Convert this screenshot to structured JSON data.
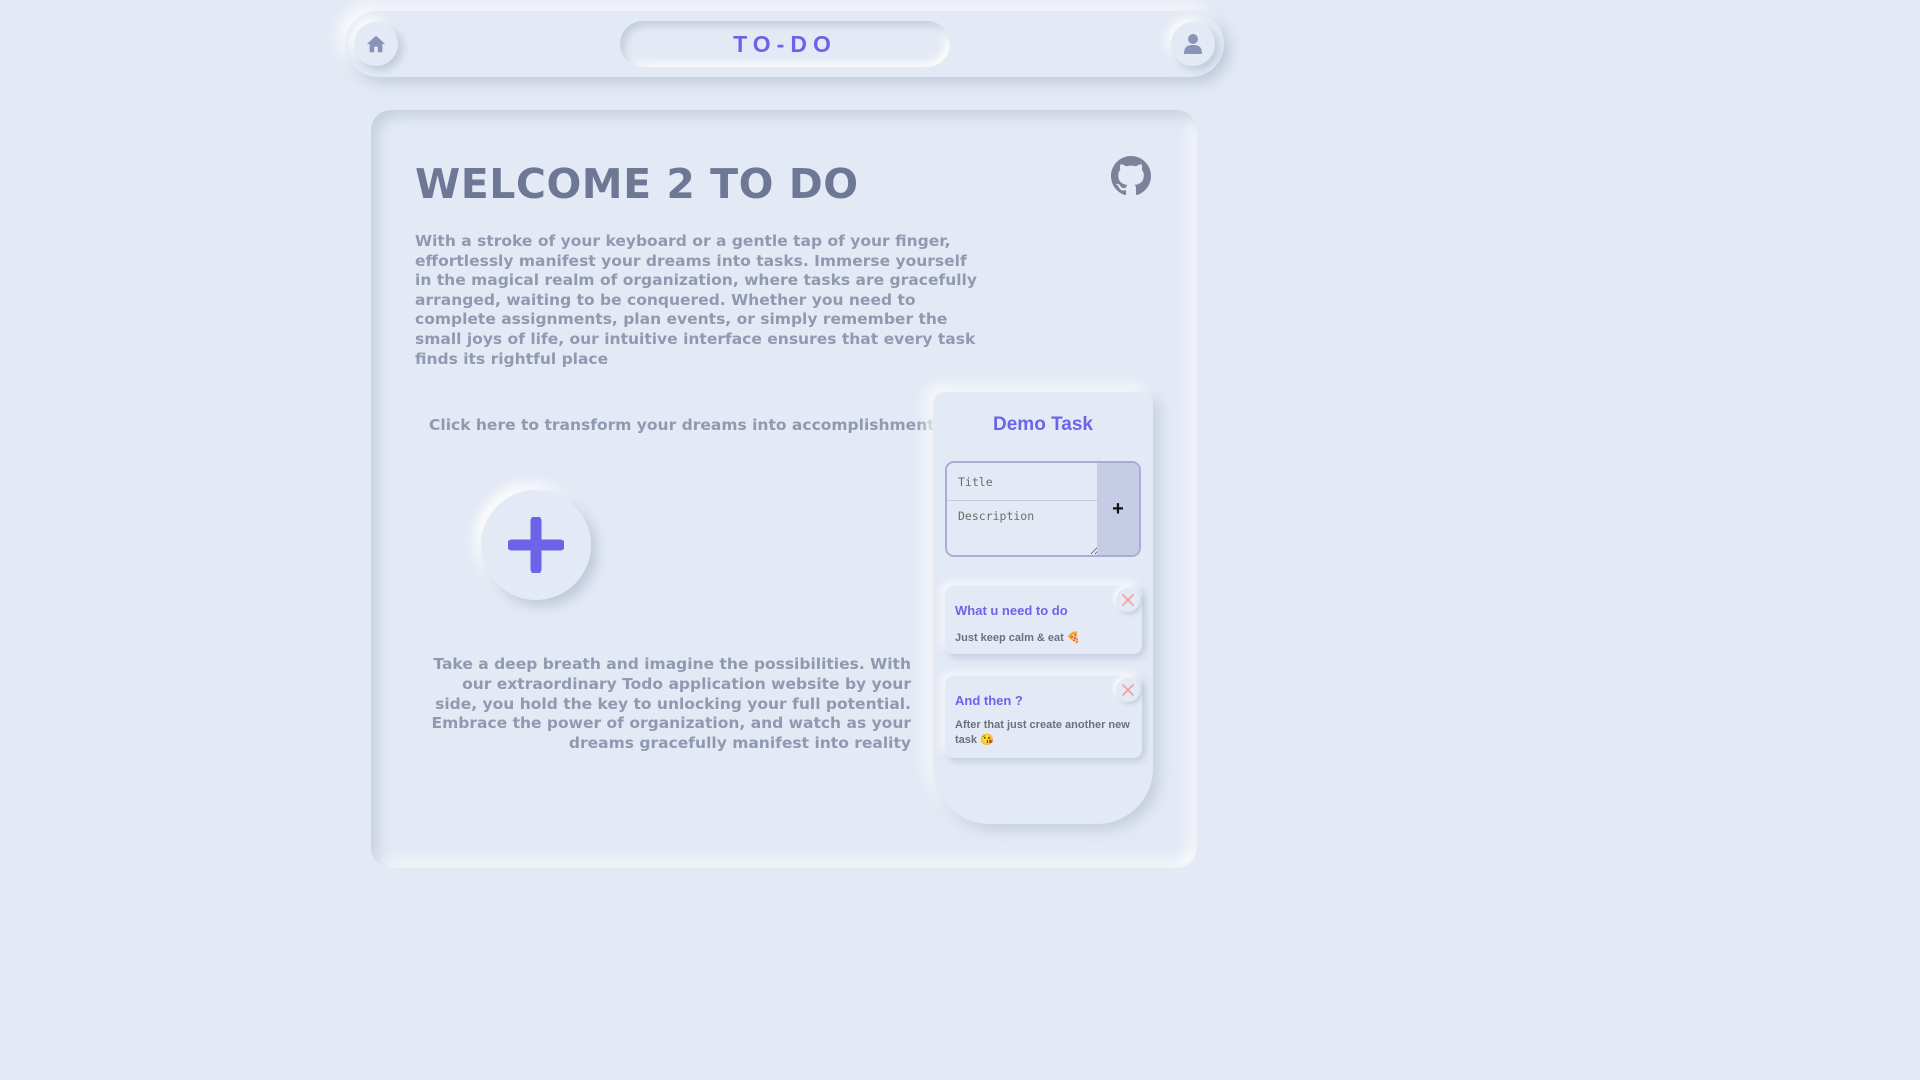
{
  "header": {
    "home_icon": "home-icon",
    "user_icon": "user-icon",
    "title": "TO-DO"
  },
  "main": {
    "heading": "WELCOME 2 TO DO",
    "github_icon": "github-icon",
    "intro": "With a stroke of your keyboard or a gentle tap of your finger, effortlessly manifest your dreams into tasks. Immerse yourself in the magical realm of organization, where tasks are gracefully arranged, waiting to be conquered. Whether you need to complete assignments, plan events, or simply remember the small joys of life, our intuitive interface ensures that every task finds its rightful place",
    "cta": "Click here to transform your dreams into accomplishments",
    "add_icon": "plus-icon",
    "outro": "Take a deep breath and imagine the possibilities. With our extraordinary Todo application website by your side, you hold the key to unlocking your full potential. Embrace the power of organization, and watch as your dreams gracefully manifest into reality"
  },
  "demo": {
    "title": "Demo Task",
    "form": {
      "title_placeholder": "Title",
      "description_placeholder": "Description",
      "add_label": "+"
    },
    "tasks": [
      {
        "title": "What u need to do",
        "description": "Just keep calm & eat 🍕"
      },
      {
        "title": "And then ?",
        "description": "After that just create another new task 😘"
      }
    ]
  },
  "colors": {
    "background": "#e4eaf5",
    "accent": "#6c63e8",
    "heading": "#6e7894",
    "body_text": "#9199b0",
    "close": "#f2a3a3"
  }
}
